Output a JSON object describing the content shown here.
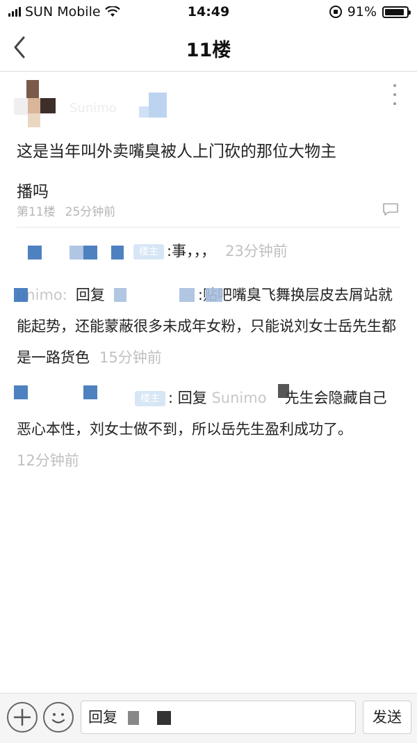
{
  "status_bar": {
    "carrier": "SUN Mobile",
    "time": "14:49",
    "battery_text": "91%",
    "battery_level": 0.91
  },
  "nav": {
    "title": "11楼",
    "back_icon": "chevron-left-icon"
  },
  "post": {
    "username": "Sunimo",
    "content": "这是当年叫外卖嘴臭被人上门砍的那位大物主播吗",
    "floor": "第11楼",
    "time": "25分钟前"
  },
  "replies": [
    {
      "author": "",
      "badge": "楼主",
      "sep": ":",
      "text": "事，，，",
      "time": "23分钟前"
    },
    {
      "author": "unimo:",
      "reply_word": "回复",
      "target": "",
      "sep": ":",
      "text": "贴吧嘴臭飞舞换层皮去屑站就能起势，还能蒙蔽很多未成年女粉，只能说刘女士岳先生都是一路货色",
      "time": "15分钟前"
    },
    {
      "author": "",
      "badge": "楼主",
      "sep": ":",
      "reply_word": "回复",
      "target": "Sunimo",
      "text": "先生会隐藏自己恶心本性，刘女士做不到，所以岳先生盈利成功了。",
      "time": "12分钟前"
    }
  ],
  "bottom_bar": {
    "plus_icon": "plus-icon",
    "emoji_icon": "emoji-icon",
    "input_value": "回复",
    "send_label": "发送"
  },
  "colors": {
    "accent": "#3b73b9",
    "muted_text": "#b5b5b5",
    "divider": "#e6e6e6"
  }
}
